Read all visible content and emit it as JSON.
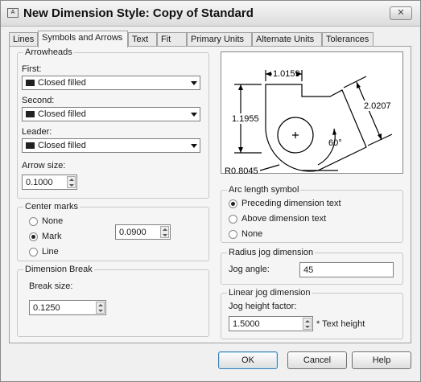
{
  "window": {
    "title": "New Dimension Style: Copy of Standard"
  },
  "tabs": [
    "Lines",
    "Symbols and Arrows",
    "Text",
    "Fit",
    "Primary Units",
    "Alternate Units",
    "Tolerances"
  ],
  "arrowheads": {
    "title": "Arrowheads",
    "first_label": "First:",
    "first_value": "Closed filled",
    "second_label": "Second:",
    "second_value": "Closed filled",
    "leader_label": "Leader:",
    "leader_value": "Closed filled",
    "size_label": "Arrow size:",
    "size_value": "0.1000"
  },
  "center_marks": {
    "title": "Center marks",
    "options": [
      "None",
      "Mark",
      "Line"
    ],
    "selected": "Mark",
    "size_value": "0.0900"
  },
  "dimension_break": {
    "title": "Dimension Break",
    "size_label": "Break size:",
    "size_value": "0.1250"
  },
  "preview": {
    "dim_top": "1.0159",
    "dim_left": "1.1955",
    "dim_right": "2.0207",
    "angle": "60°",
    "radius": "R0.8045"
  },
  "arc_length": {
    "title": "Arc length symbol",
    "options": [
      "Preceding dimension text",
      "Above dimension text",
      "None"
    ],
    "selected": "Preceding dimension text"
  },
  "radius_jog": {
    "title": "Radius jog dimension",
    "angle_label": "Jog angle:",
    "angle_value": "45"
  },
  "linear_jog": {
    "title": "Linear jog dimension",
    "height_label": "Jog height factor:",
    "height_value": "1.5000",
    "height_suffix": "* Text height"
  },
  "buttons": {
    "ok": "OK",
    "cancel": "Cancel",
    "help": "Help"
  }
}
